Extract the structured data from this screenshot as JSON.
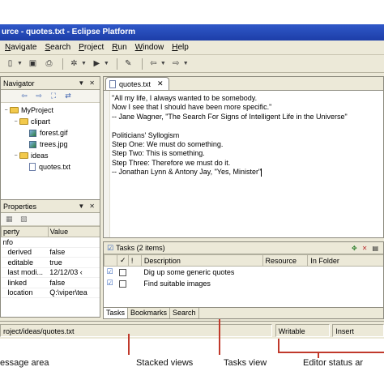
{
  "window": {
    "title": "urce - quotes.txt - Eclipse Platform"
  },
  "menu": [
    {
      "label": "Navigate",
      "u": "N",
      "rest": "avigate"
    },
    {
      "label": "Search",
      "u": "S",
      "rest": "earch"
    },
    {
      "label": "Project",
      "u": "P",
      "rest": "roject"
    },
    {
      "label": "Run",
      "u": "R",
      "rest": "un"
    },
    {
      "label": "Window",
      "u": "W",
      "rest": "indow"
    },
    {
      "label": "Help",
      "u": "H",
      "rest": "elp"
    }
  ],
  "navigator": {
    "title": "Navigator",
    "tree": [
      {
        "label": "MyProject",
        "type": "project",
        "indent": 0,
        "expander": "−"
      },
      {
        "label": "clipart",
        "type": "folder",
        "indent": 1,
        "expander": "−"
      },
      {
        "label": "forest.gif",
        "type": "image",
        "indent": 2,
        "expander": ""
      },
      {
        "label": "trees.jpg",
        "type": "image",
        "indent": 2,
        "expander": ""
      },
      {
        "label": "ideas",
        "type": "folder",
        "indent": 1,
        "expander": "−"
      },
      {
        "label": "quotes.txt",
        "type": "file",
        "indent": 2,
        "expander": ""
      }
    ]
  },
  "properties": {
    "title": "Properties",
    "columns": [
      "perty",
      "Value"
    ],
    "rows": [
      [
        "nfo",
        ""
      ],
      [
        "derived",
        "false"
      ],
      [
        "editable",
        "true"
      ],
      [
        "last modi...",
        "12/12/03 ‹"
      ],
      [
        "linked",
        "false"
      ],
      [
        "location",
        "Q:\\viper\\tea"
      ]
    ]
  },
  "editor": {
    "tab": "quotes.txt",
    "lines": [
      "\"All my life, I always wanted to be somebody.",
      "Now I see that I should have been more specific.\"",
      "-- Jane Wagner, \"The Search For Signs of Intelligent Life in the Universe\"",
      "",
      "Politicians' Syllogism",
      "Step One: We must do something.",
      "Step Two: This is something.",
      "Step Three: Therefore we must do it.",
      "-- Jonathan Lynn & Antony Jay, \"Yes, Minister\""
    ]
  },
  "tasks": {
    "title": "Tasks (2 items)",
    "columns": [
      "",
      "✓",
      "!",
      "Description",
      "Resource",
      "In Folder"
    ],
    "rows": [
      {
        "description": "Dig up some generic quotes",
        "resource": "",
        "folder": ""
      },
      {
        "description": "Find suitable images",
        "resource": "",
        "folder": ""
      }
    ],
    "tabs": [
      "Tasks",
      "Bookmarks",
      "Search"
    ]
  },
  "status": {
    "path": "roject/ideas/quotes.txt",
    "mode": "Writable",
    "insert": "Insert"
  },
  "annotations": {
    "message_area": "essage area",
    "stacked_views": "Stacked views",
    "tasks_view": "Tasks view",
    "editor_status": "Editor status ar"
  },
  "colors": {
    "titlebar": "#1d3ea8",
    "chrome": "#ece9d8",
    "marker": "#c0392b"
  }
}
